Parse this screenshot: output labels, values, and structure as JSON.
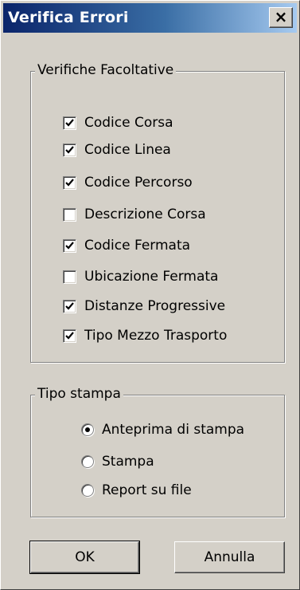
{
  "window": {
    "title": "Verifica Errori",
    "close_glyph": "×"
  },
  "optional_checks": {
    "legend": "Verifiche Facoltative",
    "items": [
      {
        "label": "Codice Corsa",
        "checked": true
      },
      {
        "label": "Codice Linea",
        "checked": true
      },
      {
        "label": "Codice Percorso",
        "checked": true
      },
      {
        "label": "Descrizione Corsa",
        "checked": false
      },
      {
        "label": "Codice Fermata",
        "checked": true
      },
      {
        "label": "Ubicazione Fermata",
        "checked": false
      },
      {
        "label": "Distanze Progressive",
        "checked": true
      },
      {
        "label": "Tipo Mezzo Trasporto",
        "checked": true
      }
    ]
  },
  "print_type": {
    "legend": "Tipo stampa",
    "options": [
      {
        "label": "Anteprima di stampa",
        "selected": true
      },
      {
        "label": "Stampa",
        "selected": false
      },
      {
        "label": "Report su file",
        "selected": false
      }
    ]
  },
  "buttons": {
    "ok_label": "OK",
    "cancel_label": "Annulla"
  }
}
